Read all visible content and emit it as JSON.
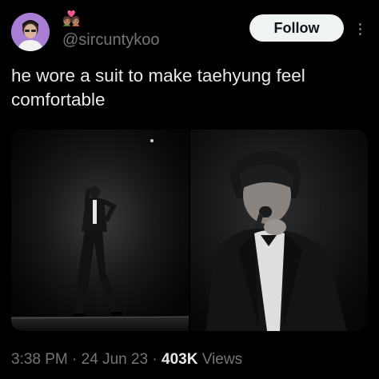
{
  "tweet": {
    "author": {
      "handle": "@sircuntykoo",
      "badge_emoji": "💑🏽",
      "avatar_icon": "avatar-photo"
    },
    "follow_label": "Follow",
    "more_icon": "more-vertical-icon",
    "text": "he wore a suit to make taehyung feel\ncomfortable",
    "media": [
      {
        "name": "media-photo-stage-wide"
      },
      {
        "name": "media-photo-closeup"
      }
    ],
    "meta": {
      "time": "3:38 PM",
      "separator": " · ",
      "date": "24 Jun 23",
      "views_count": "403K",
      "views_label": "Views"
    }
  },
  "colors": {
    "background": "#000000",
    "text": "#e7e9ea",
    "secondary_text": "#71767b",
    "follow_bg": "#eff3f4",
    "follow_text": "#0f1419"
  }
}
